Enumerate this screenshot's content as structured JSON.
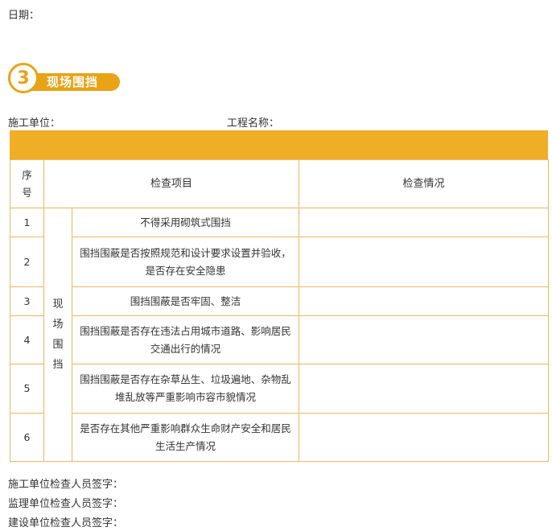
{
  "date_label": "日期：",
  "section": {
    "number": "3",
    "title": "现场围挡"
  },
  "info": {
    "construction_unit_label": "施工单位：",
    "project_name_label": "工程名称："
  },
  "table": {
    "header_seq": "序号",
    "header_seq_line1": "序",
    "header_seq_line2": "号",
    "header_items": "检查项目",
    "header_status": "检查情况",
    "category": "现场围挡",
    "category_chars": [
      "现",
      "场",
      "围",
      "挡"
    ],
    "rows": [
      {
        "seq": "1",
        "item": "不得采用砌筑式围挡",
        "status": ""
      },
      {
        "seq": "2",
        "item": "围挡围蔽是否按照规范和设计要求设置并验收，是否存在安全隐患",
        "status": ""
      },
      {
        "seq": "3",
        "item": "围挡围蔽是否牢固、整洁",
        "status": ""
      },
      {
        "seq": "4",
        "item": "围挡围蔽是否存在违法占用城市道路、影响居民交通出行的情况",
        "status": ""
      },
      {
        "seq": "5",
        "item": "围挡围蔽是否存在杂草丛生、垃圾遍地、杂物乱堆乱放等严重影响市容市貌情况",
        "status": ""
      },
      {
        "seq": "6",
        "item": "是否存在其他严重影响群众生命财产安全和居民生活生产情况",
        "status": ""
      }
    ]
  },
  "signatures": {
    "construction_inspector": "施工单位检查人员签字：",
    "supervision_inspector": "监理单位检查人员签字：",
    "owner_inspector": "建设单位检查人员签字："
  },
  "colors": {
    "accent": "#f0ae26",
    "border": "#e8b863",
    "text": "#333333"
  }
}
